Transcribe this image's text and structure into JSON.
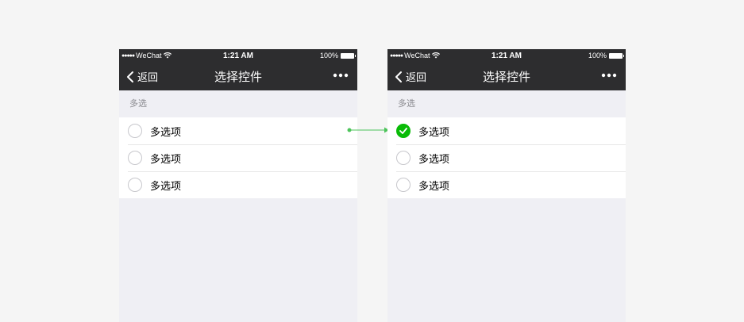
{
  "colors": {
    "background": "#f5f5f5",
    "navbar": "#2d2d2f",
    "phone_body": "#efeff4",
    "check_green": "#09bb07",
    "arrow_green": "#4cc45a"
  },
  "left_screen": {
    "statusbar": {
      "carrier": "WeChat",
      "time": "1:21 AM",
      "battery": "100%"
    },
    "navbar": {
      "back_label": "返回",
      "title": "选择控件",
      "more_icon": "more-icon"
    },
    "section_label": "多选",
    "items": [
      {
        "label": "多选项",
        "checked": false
      },
      {
        "label": "多选项",
        "checked": false
      },
      {
        "label": "多选项",
        "checked": false
      }
    ]
  },
  "right_screen": {
    "statusbar": {
      "carrier": "WeChat",
      "time": "1:21 AM",
      "battery": "100%"
    },
    "navbar": {
      "back_label": "返回",
      "title": "选择控件",
      "more_icon": "more-icon"
    },
    "section_label": "多选",
    "items": [
      {
        "label": "多选项",
        "checked": true
      },
      {
        "label": "多选项",
        "checked": false
      },
      {
        "label": "多选项",
        "checked": false
      }
    ]
  }
}
